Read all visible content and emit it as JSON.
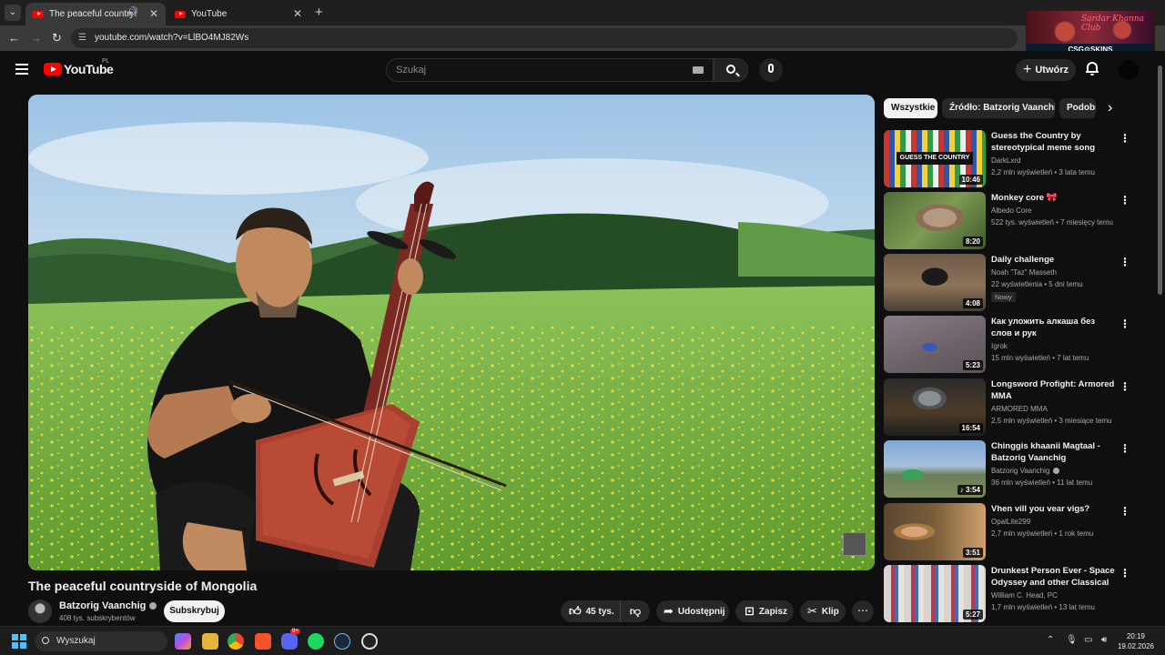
{
  "browser": {
    "tabs": [
      {
        "title": "The peaceful countryside of Mongolia - YouTube",
        "active": true,
        "audio": true
      },
      {
        "title": "YouTube",
        "active": false,
        "audio": false
      }
    ],
    "url": "youtube.com/watch?v=LlBO4MJ82Ws"
  },
  "ad": {
    "script_text": "Sardar Khanna Club",
    "brand": "CSG⚙SKINS"
  },
  "youtube": {
    "logo": "YouTube",
    "region": "PL",
    "search_placeholder": "Szukaj",
    "create_label": "Utwórz"
  },
  "video": {
    "title": "The peaceful countryside of Mongolia",
    "channel": "Batzorig Vaanchig",
    "subscribers": "408 tys. subskrybentów",
    "subscribe_label": "Subskrybuj",
    "likes": "45 tys.",
    "share_label": "Udostępnij",
    "save_label": "Zapisz",
    "clip_label": "Klip"
  },
  "chips": [
    "Wszystkie",
    "Źródło: Batzorig Vaanchig",
    "Podobne"
  ],
  "recommendations": [
    {
      "title": "Guess the Country by stereotypical meme song",
      "channel": "DarkLxrd",
      "meta": "2,2 mln wyświetleń • 3 lata temu",
      "duration": "10:46",
      "thumb_text": "GUESS THE COUNTRY",
      "verified": false,
      "badge": ""
    },
    {
      "title": "Monkey core 🎀",
      "channel": "Albedo Core",
      "meta": "522 tys. wyświetleń • 7 miesięcy temu",
      "duration": "8:20",
      "verified": false,
      "badge": ""
    },
    {
      "title": "Daily challenge",
      "channel": "Noah \"Taz\" Masseth",
      "meta": "22 wyświetlenia • 5 dni temu",
      "duration": "4:08",
      "verified": false,
      "badge": "Nowy"
    },
    {
      "title": "Как уложить алкаша без слов и рук",
      "channel": "Igrok",
      "meta": "15 mln wyświetleń • 7 lat temu",
      "duration": "5:23",
      "verified": false,
      "badge": ""
    },
    {
      "title": "Longsword Profight: Armored MMA",
      "channel": "ARMORED MMA",
      "meta": "2,5 mln wyświetleń • 3 miesiące temu",
      "duration": "16:54",
      "verified": false,
      "badge": ""
    },
    {
      "title": "Chinggis khaanii Magtaal - Batzorig Vaanchig",
      "channel": "Batzorig Vaanchig",
      "meta": "36 mln wyświetleń • 11 lat temu",
      "duration": "♪ 3:54",
      "verified": true,
      "badge": ""
    },
    {
      "title": "Vhen vill you vear vigs?",
      "channel": "OpalLite299",
      "meta": "2,7 mln wyświetleń • 1 rok temu",
      "duration": "3:51",
      "verified": false,
      "badge": ""
    },
    {
      "title": "Drunkest Person Ever - Space Odyssey and other Classical ...",
      "channel": "William C. Head, PC",
      "meta": "1,7 mln wyświetleń • 13 lat temu",
      "duration": "5:27",
      "verified": false,
      "badge": ""
    }
  ],
  "taskbar": {
    "search_label": "Wyszukaj",
    "badge": "9+",
    "time": "20:19",
    "date": "19.02.2026"
  }
}
